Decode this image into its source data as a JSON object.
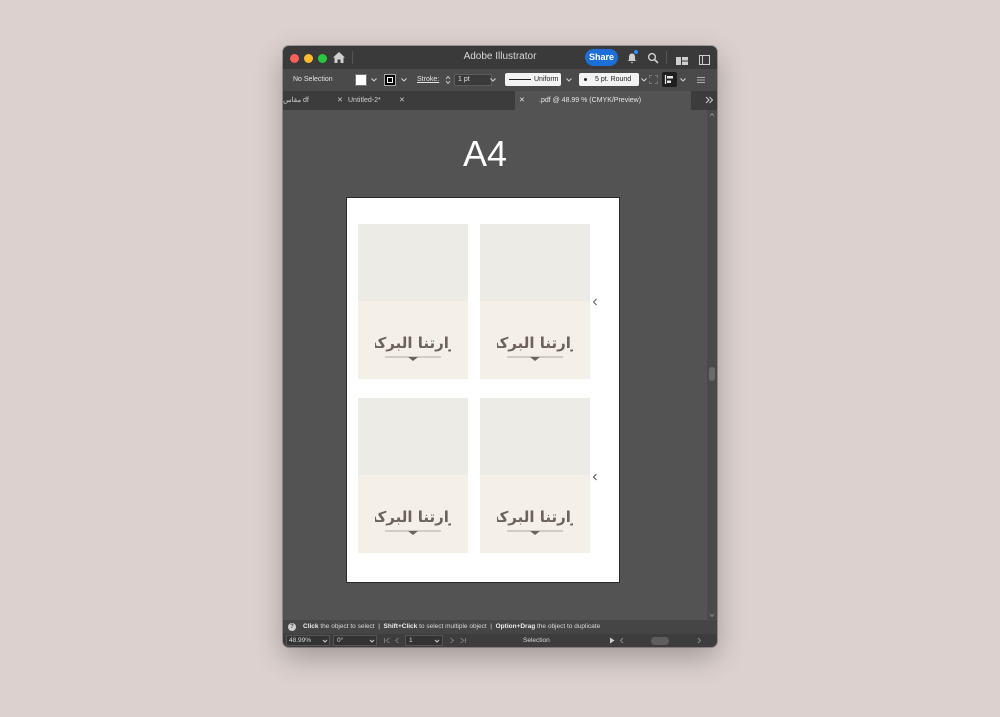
{
  "window": {
    "title": "Adobe Illustrator",
    "share_label": "Share"
  },
  "control_bar": {
    "selection_label": "No Selection",
    "stroke_label": "Stroke:",
    "stroke_weight": "1 pt",
    "profile_label": "Uniform",
    "brush_label": "5 pt. Round"
  },
  "tabs": [
    {
      "label": "مقاس df"
    },
    {
      "label": "Untitled-2*"
    },
    {
      "label": ".pdf @ 48.99 % (CMYK/Preview)"
    }
  ],
  "canvas": {
    "heading": "A4",
    "cards": [
      {
        "logo_text": "زارتنا البركة"
      },
      {
        "logo_text": "زارتنا البركة"
      },
      {
        "logo_text": "زارتنا البركة"
      },
      {
        "logo_text": "زارتنا البركة"
      }
    ]
  },
  "status_bar": {
    "hint_1_bold": "Click",
    "hint_1_rest": "the object to select",
    "hint_2_bold": "Shift+Click",
    "hint_2_rest": "to select multiple object",
    "hint_3_bold": "Option+Drag",
    "hint_3_rest": "the object to duplicate",
    "separator": "|"
  },
  "bottom_bar": {
    "zoom": "48.99%",
    "rotation": "0°",
    "artboard": "1",
    "mode": "Selection"
  },
  "colors": {
    "share_button": "#1c6fd8",
    "canvas_bg": "#535353",
    "card_top": "#edebe6",
    "card_bottom": "#f4f0e8",
    "logo_ink": "#6b635c"
  }
}
